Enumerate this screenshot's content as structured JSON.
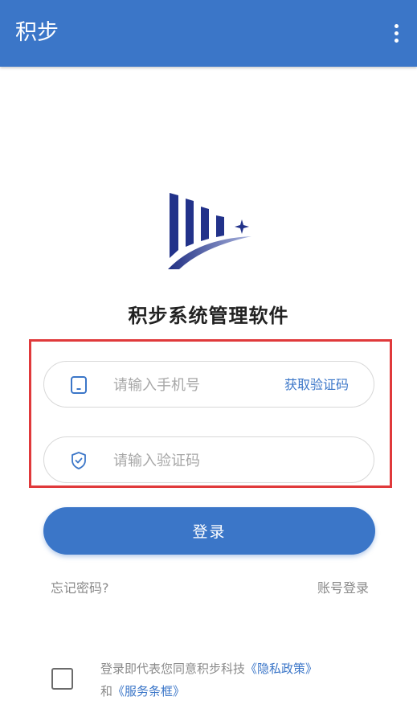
{
  "appbar": {
    "title": "积步",
    "menu_icon": "more-vertical-icon"
  },
  "brand": {
    "logo_icon": "bar-chart-arc-logo",
    "name": "积步系统管理软件"
  },
  "form": {
    "phone": {
      "icon": "phone-icon",
      "placeholder": "请输入手机号",
      "value": ""
    },
    "get_code_label": "获取验证码",
    "code": {
      "icon": "shield-check-icon",
      "placeholder": "请输入验证码",
      "value": ""
    }
  },
  "login_button": "登录",
  "links": {
    "forgot_password": "忘记密码?",
    "account_login": "账号登录"
  },
  "agreement": {
    "checked": false,
    "text": "登录即代表您同意积步科技",
    "privacy_policy": "《隐私政策》",
    "and": "和",
    "service_terms": "《服务条框》"
  },
  "colors": {
    "primary": "#3b76c8",
    "logo_navy": "#22328a",
    "highlight": "#e0393b"
  }
}
